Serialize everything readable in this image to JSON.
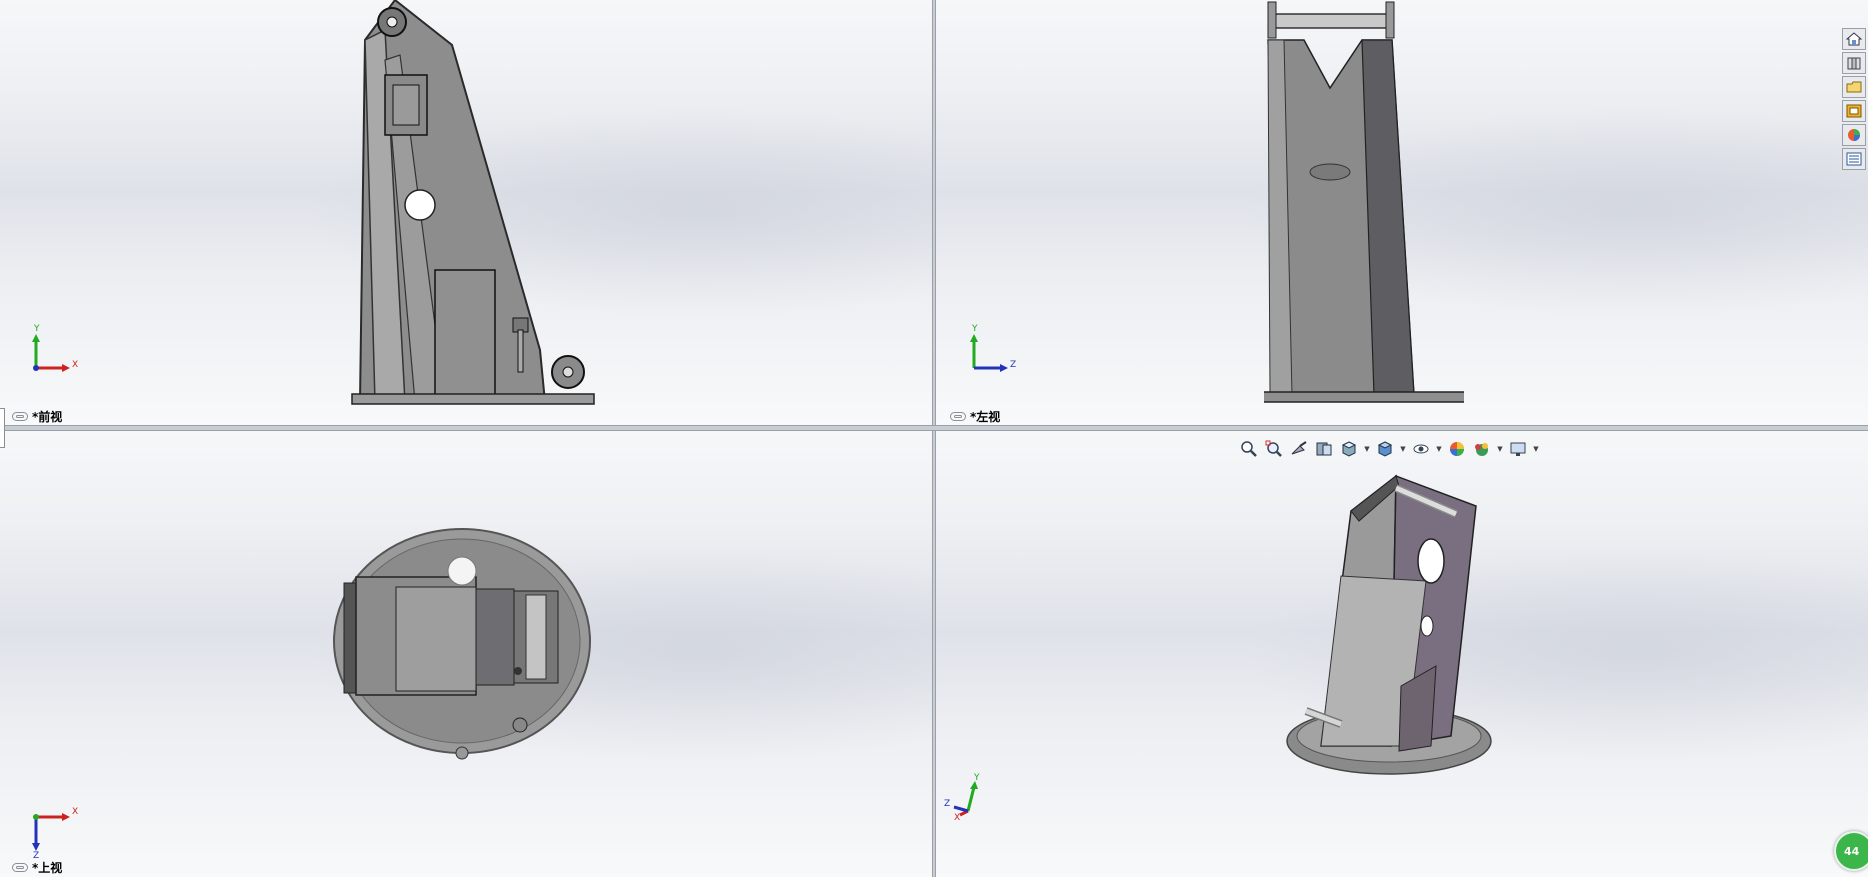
{
  "viewports": {
    "front": {
      "label": "*前视",
      "triad": {
        "y": "Y",
        "x": "X"
      }
    },
    "left": {
      "label": "*左视",
      "triad": {
        "y": "Y",
        "x": "Z"
      }
    },
    "top": {
      "label": "*上视",
      "triad": {
        "x": "X",
        "y": "Z"
      }
    },
    "iso": {
      "triad": {
        "y": "Y",
        "x": "X",
        "z": "Z"
      }
    }
  },
  "heads_up_toolbar": {
    "icons": [
      "zoom-to-fit-icon",
      "zoom-to-area-icon",
      "previous-view-icon",
      "section-view-icon",
      "view-orientation-icon",
      "display-style-icon",
      "hide-show-items-icon",
      "edit-appearance-icon",
      "apply-scene-icon",
      "view-settings-icon"
    ]
  },
  "task_pane": {
    "icons": [
      "home-icon",
      "design-library-icon",
      "file-explorer-icon",
      "view-palette-icon",
      "appearances-icon",
      "custom-properties-icon"
    ]
  },
  "status_bubble": {
    "value": "44"
  },
  "colors": {
    "model_body": "#8e8e8e",
    "iso_plate": "#7a6f80",
    "axis_x": "#cc2222",
    "axis_y": "#22aa22",
    "axis_z": "#2233bb"
  }
}
